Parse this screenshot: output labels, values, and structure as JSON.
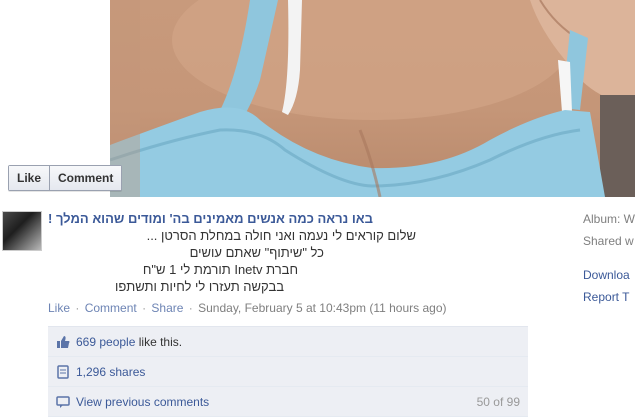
{
  "photo": {
    "like_label": "Like",
    "comment_label": "Comment"
  },
  "post": {
    "title": "באו נראה כמה אנשים מאמינים בה' ומודים שהוא המלך !",
    "lines": [
      "שלום קוראים לי נעמה ואני חולה במחלת הסרטן ...",
      "כל \"שיתוף\" שאתם עושים",
      "חברת Inetv תורמת לי 1 ש\"ח",
      "בבקשה תעזרו לי לחיות ותשתפו"
    ],
    "actions": {
      "like": "Like",
      "comment": "Comment",
      "share": "Share",
      "timestamp": "Sunday, February 5 at 10:43pm (11 hours ago)"
    }
  },
  "ufi": {
    "likes_count": "669 people",
    "likes_suffix": "like this.",
    "shares": "1,296 shares",
    "view_previous": "View previous comments",
    "comments_count": "50 of 99"
  },
  "sidebar": {
    "album_label": "Album: W",
    "shared_label": "Shared w",
    "download_label": "Downloa",
    "report_label": "Report T"
  },
  "colors": {
    "link": "#3b5998",
    "ufi_bg": "#edeff4",
    "meta": "#7f7f7f"
  }
}
